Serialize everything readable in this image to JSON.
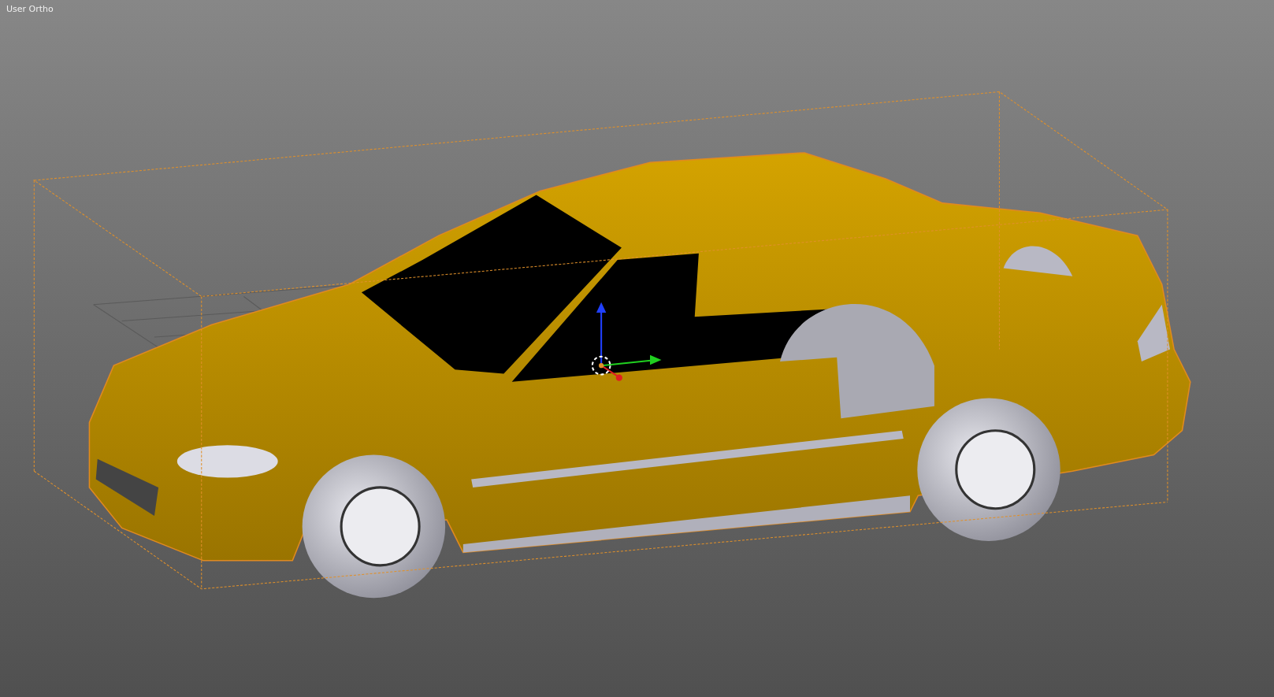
{
  "viewport": {
    "view_label": "User Ortho"
  }
}
